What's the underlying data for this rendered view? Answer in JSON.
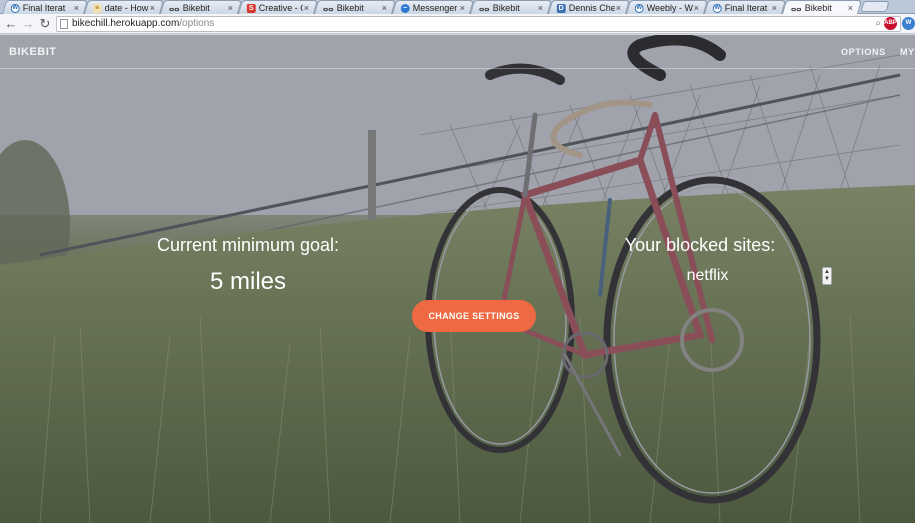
{
  "browser": {
    "tabs": [
      {
        "label": "Final Iterat",
        "icon": "wordpress-icon",
        "active": false
      },
      {
        "label": "date - How",
        "icon": "document-icon",
        "active": false
      },
      {
        "label": "Bikebit",
        "icon": "bike-icon",
        "active": false
      },
      {
        "label": "Creative - C",
        "icon": "s-logo-icon",
        "active": false
      },
      {
        "label": "Bikebit",
        "icon": "bike-icon",
        "active": false
      },
      {
        "label": "Messenger",
        "icon": "messenger-icon",
        "active": false
      },
      {
        "label": "Bikebit",
        "icon": "bike-icon",
        "active": false
      },
      {
        "label": "Dennis Che",
        "icon": "linkedin-icon",
        "active": false
      },
      {
        "label": "Weebly - W",
        "icon": "wordpress-icon",
        "active": false
      },
      {
        "label": "Final Iterat",
        "icon": "wordpress-icon",
        "active": false
      },
      {
        "label": "Bikebit",
        "icon": "bike-icon",
        "active": true
      }
    ],
    "close_glyph": "×",
    "url_host": "bikechill.herokuapp.com",
    "url_path": "/options",
    "extensions": {
      "adblock": "ABP",
      "other": "W"
    }
  },
  "site": {
    "brand": "BIKEBIT",
    "nav": {
      "options": "OPTIONS",
      "my": "MY"
    }
  },
  "main": {
    "goal_label": "Current minimum goal:",
    "goal_value": "5 miles",
    "blocked_label": "Your blocked sites:",
    "blocked_sites": [
      "netflix"
    ],
    "change_button": "CHANGE SETTINGS"
  },
  "colors": {
    "accent": "#ef6a43",
    "text_on_image": "#ffffff"
  }
}
